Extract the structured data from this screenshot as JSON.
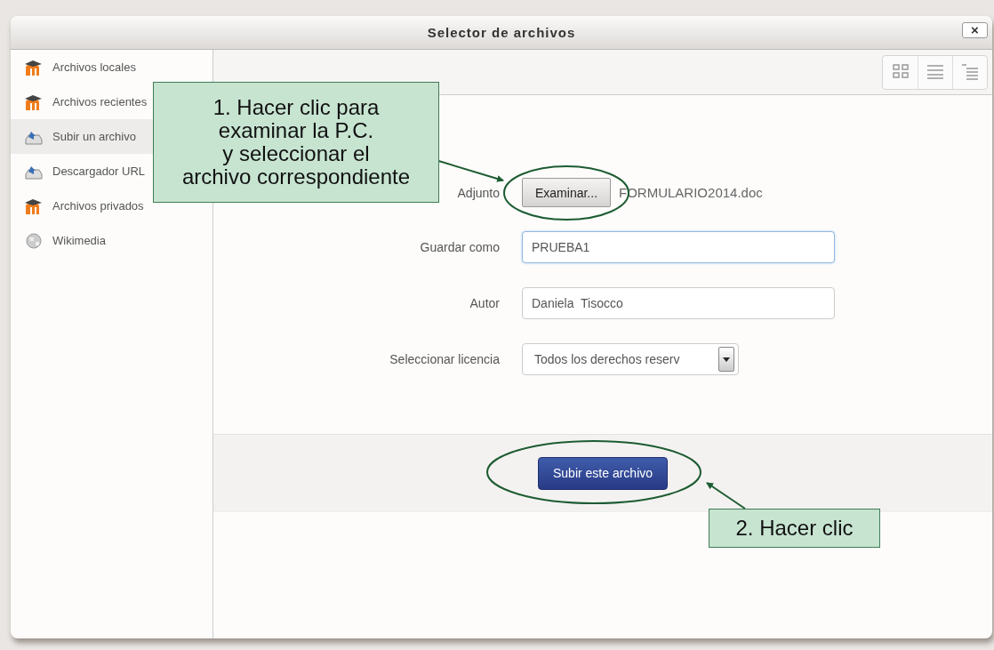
{
  "window": {
    "title": "Selector de archivos",
    "close": "×"
  },
  "sidebar": {
    "items": [
      {
        "label": "Archivos locales",
        "kind": "moodle",
        "selected": false
      },
      {
        "label": "Archivos recientes",
        "kind": "moodle",
        "selected": false
      },
      {
        "label": "Subir un archivo",
        "kind": "upload",
        "selected": true
      },
      {
        "label": "Descargador URL",
        "kind": "upload",
        "selected": false
      },
      {
        "label": "Archivos privados",
        "kind": "moodle",
        "selected": false
      },
      {
        "label": "Wikimedia",
        "kind": "globe",
        "selected": false
      }
    ]
  },
  "toolbar": {
    "views": [
      {
        "kind": "grid"
      },
      {
        "kind": "list"
      },
      {
        "kind": "tree"
      }
    ]
  },
  "form": {
    "rows": [
      {
        "kind": "file",
        "label": "Adjunto",
        "button": "Examinar...",
        "value": "FORMULARIO2014.doc"
      },
      {
        "kind": "text",
        "label": "Guardar como",
        "value": "PRUEBA1",
        "focused": true
      },
      {
        "kind": "text",
        "label": "Autor",
        "value": "Daniela  Tisocco",
        "focused": false
      },
      {
        "kind": "select",
        "label": "Seleccionar licencia",
        "value": "Todos los derechos reserv"
      }
    ]
  },
  "submit": {
    "label": "Subir este archivo"
  },
  "annotations": [
    {
      "text": "1. Hacer clic para\nexaminar la P.C.\ny seleccionar el\narchivo correspondiente"
    },
    {
      "text": "2. Hacer clic"
    }
  ]
}
